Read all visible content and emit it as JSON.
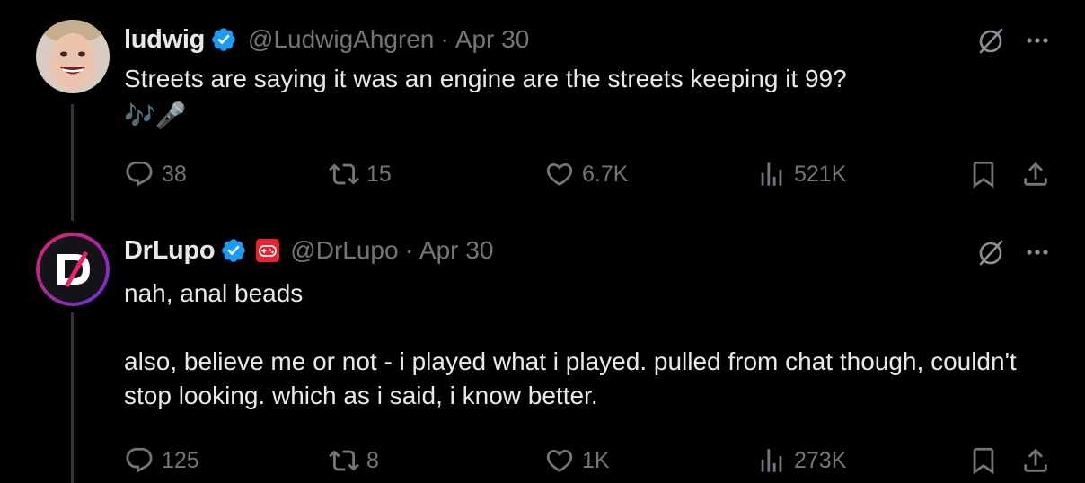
{
  "colors": {
    "background": "#000000",
    "text_primary": "#e7e9ea",
    "text_secondary": "#71767b",
    "verified_blue": "#1d9bf0",
    "thread_line": "#333639",
    "affiliate_red": "#e8232d"
  },
  "tweets": [
    {
      "display_name": "ludwig",
      "verified": true,
      "handle": "@LudwigAhgren",
      "separator": "·",
      "time": "Apr 30",
      "text": "Streets are saying it was an engine are the streets keeping it 99?",
      "emoji": "🎶🎤",
      "stats": {
        "replies": "38",
        "reposts": "15",
        "likes": "6.7K",
        "views": "521K"
      },
      "icons": [
        "grok-icon",
        "more-icon",
        "reply-icon",
        "repost-icon",
        "like-icon",
        "views-icon",
        "bookmark-icon",
        "share-icon"
      ]
    },
    {
      "display_name": "DrLupo",
      "verified": true,
      "affiliate_badge": "controller-badge-icon",
      "handle": "@DrLupo",
      "separator": "·",
      "time": "Apr 30",
      "paragraphs": [
        "nah, anal beads",
        "also, believe me or not - i played what i played. pulled from chat though, couldn't stop looking. which as i said, i know better."
      ],
      "stats": {
        "replies": "125",
        "reposts": "8",
        "likes": "1K",
        "views": "273K"
      },
      "icons": [
        "grok-icon",
        "more-icon",
        "reply-icon",
        "repost-icon",
        "like-icon",
        "views-icon",
        "bookmark-icon",
        "share-icon"
      ]
    }
  ]
}
